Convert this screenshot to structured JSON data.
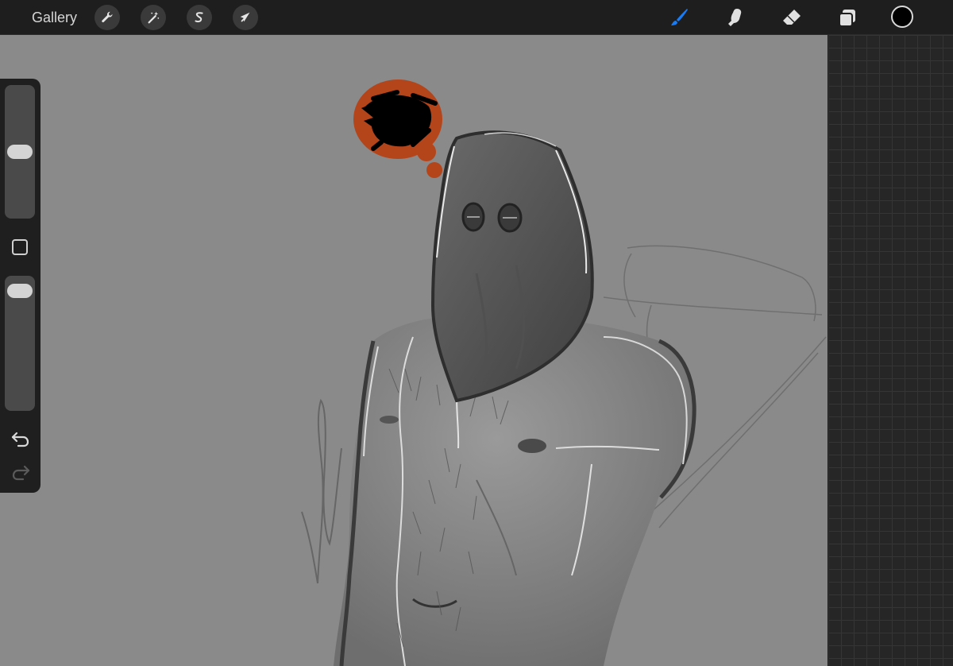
{
  "topbar": {
    "gallery_label": "Gallery",
    "left_tools": [
      {
        "name": "actions",
        "icon": "wrench-icon"
      },
      {
        "name": "adjustments",
        "icon": "magic-wand-icon"
      },
      {
        "name": "selection",
        "icon": "selection-s-icon"
      },
      {
        "name": "transform",
        "icon": "arrow-cursor-icon"
      }
    ],
    "right_tools": [
      {
        "name": "brush",
        "icon": "brush-icon",
        "active": true
      },
      {
        "name": "smudge",
        "icon": "smudge-finger-icon",
        "active": false
      },
      {
        "name": "eraser",
        "icon": "eraser-icon",
        "active": false
      },
      {
        "name": "layers",
        "icon": "layers-icon",
        "active": false
      }
    ],
    "current_color": "#000000",
    "active_color": "#1a7cf5"
  },
  "sidebar": {
    "brush_size_level": 0.5,
    "opacity_level": 0.95,
    "modify_icon": "square-icon",
    "undo_icon": "undo-arrow-icon",
    "redo_icon": "redo-arrow-icon"
  },
  "canvas": {
    "background": "#8a8a8a",
    "thought_bubble_color": "#b4451b"
  }
}
